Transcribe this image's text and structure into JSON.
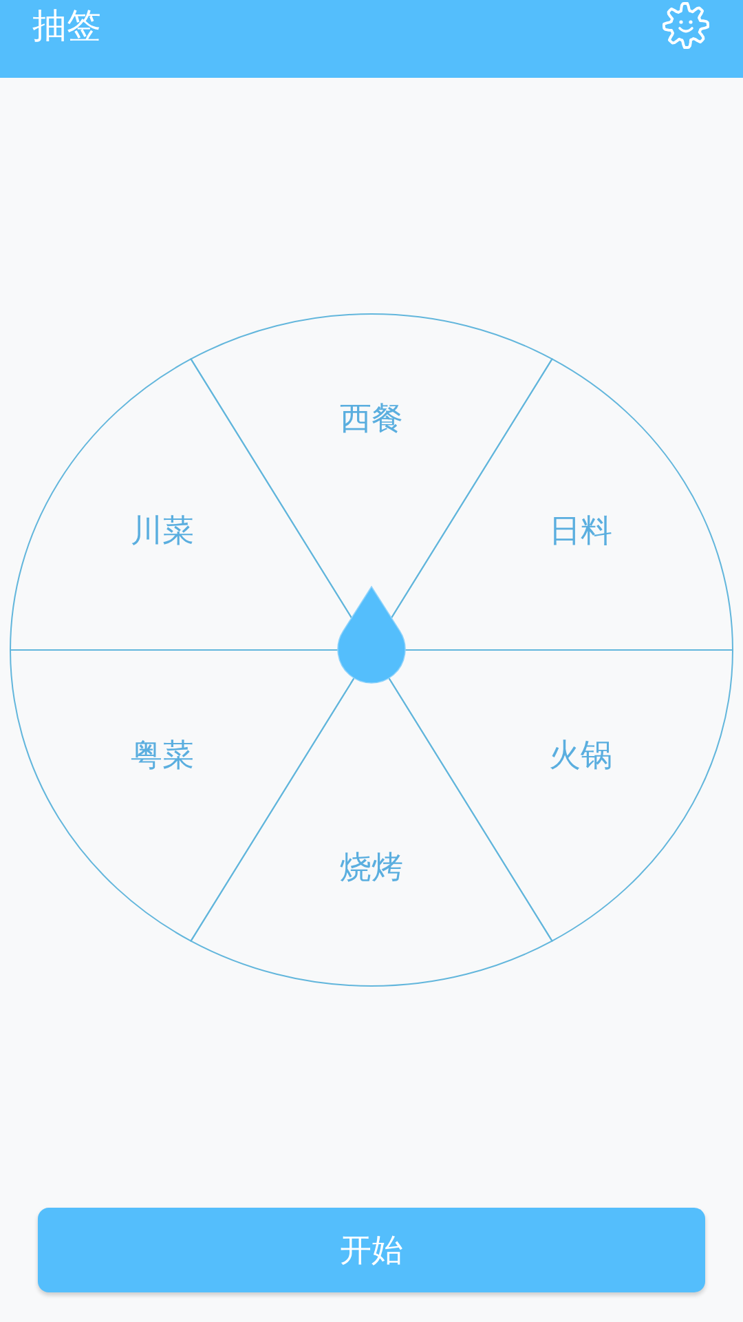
{
  "app_bar": {
    "title": "抽签"
  },
  "wheel": {
    "segments": [
      {
        "label": "西餐"
      },
      {
        "label": "日料"
      },
      {
        "label": "火锅"
      },
      {
        "label": "烧烤"
      },
      {
        "label": "粤菜"
      },
      {
        "label": "川菜"
      }
    ]
  },
  "start_button": {
    "label": "开始"
  }
}
